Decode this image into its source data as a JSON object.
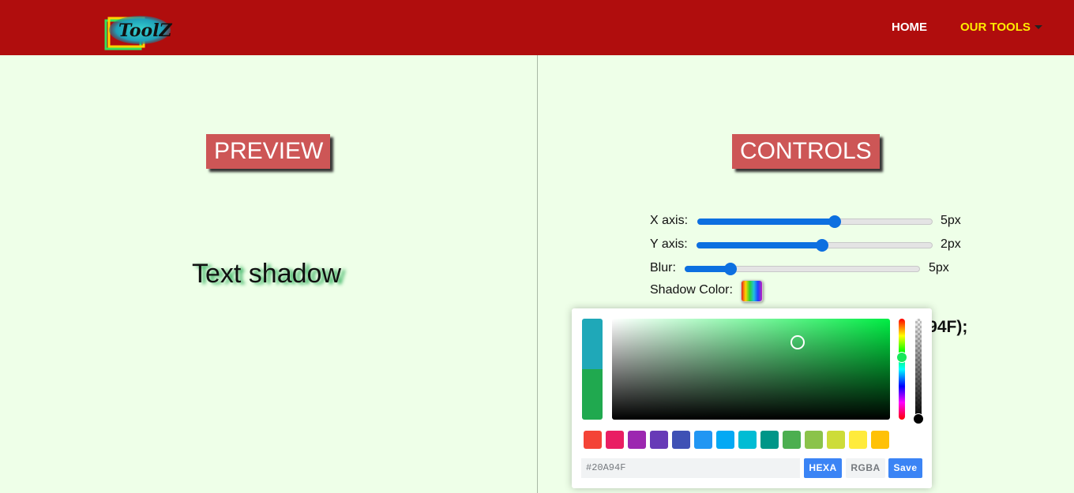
{
  "nav": {
    "logo_text": "ToolZ",
    "home": "HOME",
    "our_tools": "OUR TOOLS"
  },
  "preview": {
    "title": "PREVIEW",
    "sample_text": "Text shadow"
  },
  "controls": {
    "title": "CONTROLS",
    "x_axis": {
      "label": "X axis:",
      "value": "5px",
      "fraction": 0.58
    },
    "y_axis": {
      "label": "Y axis:",
      "value": "2px",
      "fraction": 0.53
    },
    "blur": {
      "label": "Blur:",
      "value": "5px",
      "fraction": 0.19
    },
    "shadow_color_label": "Shadow Color:",
    "css_output_visible": "A94F);"
  },
  "picker": {
    "previous_color": "#1FA8B8",
    "current_color": "#20A94F",
    "hue_color": "#00EE44",
    "swatches": [
      "#F44336",
      "#E91E63",
      "#9C27B0",
      "#673AB7",
      "#3F51B5",
      "#2196F3",
      "#03A9F4",
      "#00BCD4",
      "#009688",
      "#4CAF50",
      "#8BC34A",
      "#CDDC39",
      "#FFEB3B",
      "#FFC107"
    ],
    "hex_value": "#20A94F",
    "hexa_label": "HEXA",
    "rgba_label": "RGBA",
    "save_label": "Save"
  },
  "colors": {
    "navbar": "#B00D0D",
    "background": "#EEFFE8",
    "title_box": "#CD5656",
    "slider_accent": "#0D6FE0",
    "nav_active": "#FFEB00"
  }
}
